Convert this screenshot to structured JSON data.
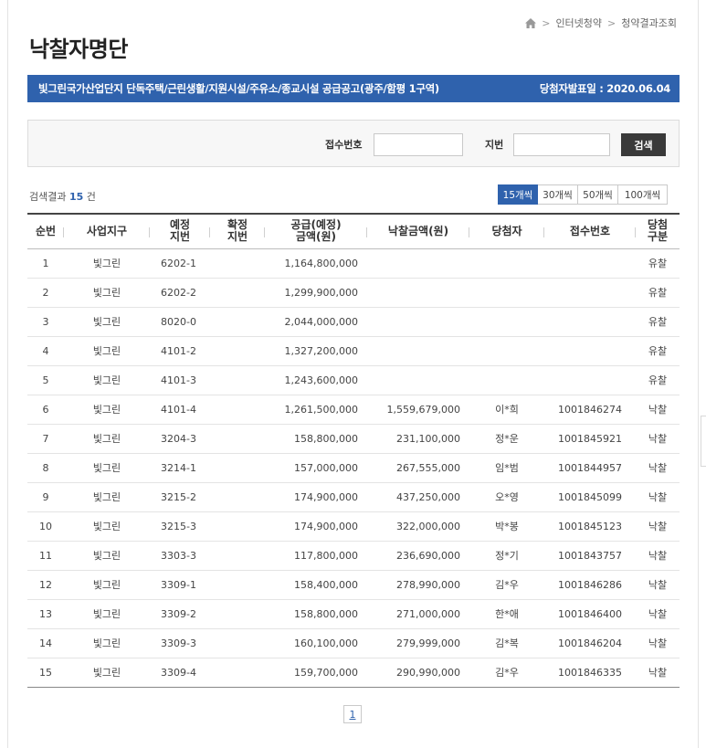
{
  "breadcrumb": {
    "items": [
      "인터넷청약",
      "청약결과조회"
    ]
  },
  "page_title": "낙찰자명단",
  "notice": {
    "title": "빛그린국가산업단지 단독주택/근린생활/지원시설/주유소/종교시설 공급공고(광주/함평 1구역)",
    "announce": "당첨자발표일 : 2020.06.04"
  },
  "search": {
    "receipt_label": "접수번호",
    "receipt_value": "",
    "lot_label": "지번",
    "lot_value": "",
    "button": "검색"
  },
  "result": {
    "prefix": "검색결과",
    "count": "15",
    "suffix": "건"
  },
  "page_size": {
    "options": [
      "15개씩",
      "30개씩",
      "50개씩",
      "100개씩"
    ],
    "selected": "15개씩"
  },
  "table": {
    "headers": [
      {
        "l1": "순번",
        "l2": ""
      },
      {
        "l1": "사업지구",
        "l2": ""
      },
      {
        "l1": "예정",
        "l2": "지번"
      },
      {
        "l1": "확정",
        "l2": "지번"
      },
      {
        "l1": "공급(예정)",
        "l2": "금액(원)"
      },
      {
        "l1": "낙찰금액(원)",
        "l2": ""
      },
      {
        "l1": "당첨자",
        "l2": ""
      },
      {
        "l1": "접수번호",
        "l2": ""
      },
      {
        "l1": "당첨",
        "l2": "구분"
      }
    ],
    "rows": [
      [
        "1",
        "빛그린",
        "6202-1",
        "",
        "1,164,800,000",
        "",
        "",
        "",
        "유찰"
      ],
      [
        "2",
        "빛그린",
        "6202-2",
        "",
        "1,299,900,000",
        "",
        "",
        "",
        "유찰"
      ],
      [
        "3",
        "빛그린",
        "8020-0",
        "",
        "2,044,000,000",
        "",
        "",
        "",
        "유찰"
      ],
      [
        "4",
        "빛그린",
        "4101-2",
        "",
        "1,327,200,000",
        "",
        "",
        "",
        "유찰"
      ],
      [
        "5",
        "빛그린",
        "4101-3",
        "",
        "1,243,600,000",
        "",
        "",
        "",
        "유찰"
      ],
      [
        "6",
        "빛그린",
        "4101-4",
        "",
        "1,261,500,000",
        "1,559,679,000",
        "이*희",
        "1001846274",
        "낙찰"
      ],
      [
        "7",
        "빛그린",
        "3204-3",
        "",
        "158,800,000",
        "231,100,000",
        "정*운",
        "1001845921",
        "낙찰"
      ],
      [
        "8",
        "빛그린",
        "3214-1",
        "",
        "157,000,000",
        "267,555,000",
        "임*범",
        "1001844957",
        "낙찰"
      ],
      [
        "9",
        "빛그린",
        "3215-2",
        "",
        "174,900,000",
        "437,250,000",
        "오*영",
        "1001845099",
        "낙찰"
      ],
      [
        "10",
        "빛그린",
        "3215-3",
        "",
        "174,900,000",
        "322,000,000",
        "박*봉",
        "1001845123",
        "낙찰"
      ],
      [
        "11",
        "빛그린",
        "3303-3",
        "",
        "117,800,000",
        "236,690,000",
        "정*기",
        "1001843757",
        "낙찰"
      ],
      [
        "12",
        "빛그린",
        "3309-1",
        "",
        "158,400,000",
        "278,990,000",
        "김*우",
        "1001846286",
        "낙찰"
      ],
      [
        "13",
        "빛그린",
        "3309-2",
        "",
        "158,800,000",
        "271,000,000",
        "한*애",
        "1001846400",
        "낙찰"
      ],
      [
        "14",
        "빛그린",
        "3309-3",
        "",
        "160,100,000",
        "279,999,000",
        "김*복",
        "1001846204",
        "낙찰"
      ],
      [
        "15",
        "빛그린",
        "3309-4",
        "",
        "159,700,000",
        "290,990,000",
        "김*우",
        "1001846335",
        "낙찰"
      ]
    ]
  },
  "pagination": {
    "pages": [
      "1"
    ],
    "current": "1"
  },
  "colors": {
    "accent": "#2f62ad",
    "dark_button": "#3a3a3a"
  }
}
